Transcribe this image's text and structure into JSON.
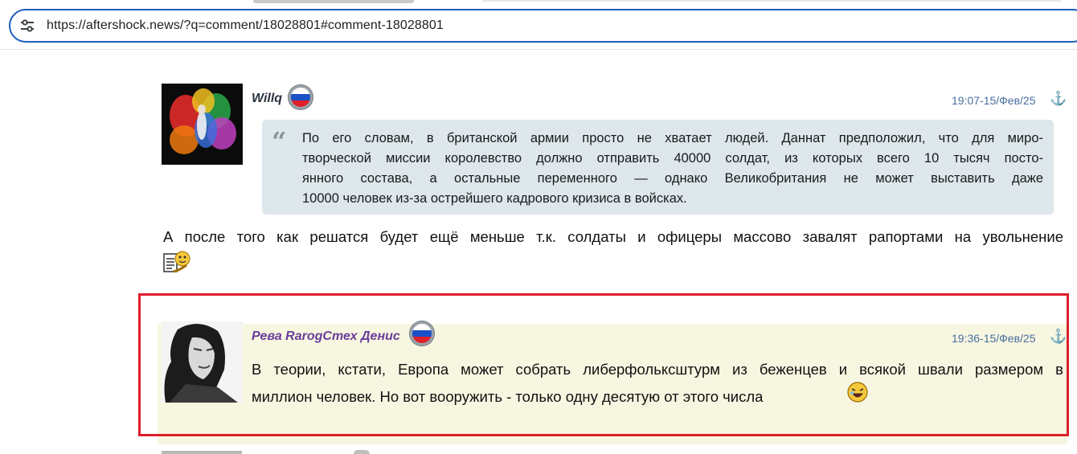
{
  "browser": {
    "url": "https://aftershock.news/?q=comment/18028801#comment-18028801",
    "site_info_icon": "tune-icon"
  },
  "comments": [
    {
      "author": "Willq",
      "author_color": "#2b3440",
      "country_icon": "russia-flag-icon",
      "timestamp": "19:07-15/Фев/25",
      "permalink_icon": "anchor-icon",
      "quote_lines": [
        "По его словам, в британской армии просто не хватает людей. Даннат предположил, что для миро-",
        "творческой миссии королевство должно отправить 40000 солдат, из которых всего 10 тысяч посто-",
        "янного состава, а остальные переменного — однако Великобритания не может выставить даже",
        "10000 человек из-за острейшего кадрового кризиса в войсках."
      ],
      "reply": "А после того как решатся будет ещё меньше т.к. солдаты и офицеры массово завалят рапортами на увольнение",
      "reply_emoji": "paperwork-smiley-icon"
    },
    {
      "author": "Рева RarogСтех Денис",
      "author_color": "#6a3d9a",
      "country_icon": "russia-flag-icon",
      "timestamp": "19:36-15/Фев/25",
      "permalink_icon": "anchor-icon",
      "text_lines": [
        "В теории, кстати, Европа может собрать либерфольксштурм из беженцев и всякой швали размером в",
        "миллион человек. Но вот вооружить - только одну десятую от этого числа"
      ],
      "emoji": "laughing-smiley-icon",
      "highlight_color": "#f7f6e1",
      "selection_color": "#dc1f2a"
    }
  ]
}
